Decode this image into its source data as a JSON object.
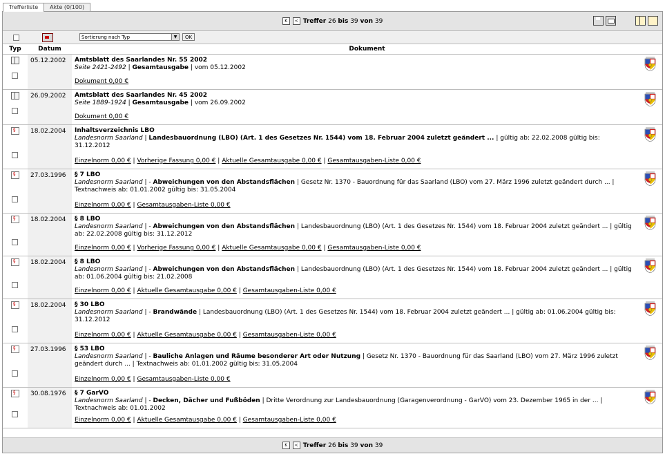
{
  "tabs": [
    {
      "label": "Trefferliste"
    },
    {
      "label": "Akte (0/100)"
    }
  ],
  "pager": {
    "prefix": "Treffer",
    "from": "26",
    "bis": "bis",
    "to": "39",
    "von": "von",
    "total": "39"
  },
  "sort": {
    "selected": "Sortierung nach Typ",
    "ok_label": "OK"
  },
  "columns": {
    "typ": "Typ",
    "datum": "Datum",
    "dokument": "Dokument"
  },
  "rows": [
    {
      "icon": "book-icon",
      "date": "05.12.2002",
      "title": "Amtsblatt des Saarlandes Nr. 55 2002",
      "line2_italic": "Seite 2421-2492",
      "line2_sep": "|",
      "line2_bold": "Gesamtausgabe",
      "line2_rest": "| vom 05.12.2002",
      "links": [
        "Dokument 0,00 €"
      ]
    },
    {
      "icon": "book-icon",
      "date": "26.09.2002",
      "title": "Amtsblatt des Saarlandes Nr. 45 2002",
      "line2_italic": "Seite 1889-1924",
      "line2_sep": "|",
      "line2_bold": "Gesamtausgabe",
      "line2_rest": "| vom 26.09.2002",
      "links": [
        "Dokument 0,00 €"
      ]
    },
    {
      "icon": "norm-icon",
      "date": "18.02.2004",
      "title": "Inhaltsverzeichnis LBO",
      "line2_italic": "Landesnorm Saarland",
      "line2_sep": "|",
      "line2_bold": "Landesbauordnung (LBO) (Art. 1 des Gesetzes Nr. 1544) vom 18. Februar 2004 zuletzt geändert ...",
      "line2_rest": "| gültig ab: 22.02.2008 gültig bis: 31.12.2012",
      "links": [
        "Einzelnorm 0,00 €",
        "Vorherige Fassung 0,00 €",
        "Aktuelle Gesamtausgabe 0,00 €",
        "Gesamtausgaben-Liste 0,00 €"
      ]
    },
    {
      "icon": "norm-icon",
      "date": "27.03.1996",
      "title": "§ 7 LBO",
      "line2_italic": "Landesnorm Saarland",
      "line2_sep": "| -",
      "line2_bold": "Abweichungen von den Abstandsflächen",
      "line2_rest": "| Gesetz Nr. 1370 - Bauordnung für das Saarland (LBO) vom 27. März 1996 zuletzt geändert durch ... | Textnachweis ab: 01.01.2002 gültig bis: 31.05.2004",
      "links": [
        "Einzelnorm 0,00 €",
        "Gesamtausgaben-Liste 0,00 €"
      ]
    },
    {
      "icon": "norm-icon",
      "date": "18.02.2004",
      "title": "§ 8 LBO",
      "line2_italic": "Landesnorm Saarland",
      "line2_sep": "| -",
      "line2_bold": "Abweichungen von den Abstandsflächen",
      "line2_rest": "| Landesbauordnung (LBO) (Art. 1 des Gesetzes Nr. 1544) vom 18. Februar 2004 zuletzt geändert ... | gültig ab: 22.02.2008 gültig bis: 31.12.2012",
      "links": [
        "Einzelnorm 0,00 €",
        "Vorherige Fassung 0,00 €",
        "Aktuelle Gesamtausgabe 0,00 €",
        "Gesamtausgaben-Liste 0,00 €"
      ]
    },
    {
      "icon": "norm-icon",
      "date": "18.02.2004",
      "title": "§ 8 LBO",
      "line2_italic": "Landesnorm Saarland",
      "line2_sep": "| -",
      "line2_bold": "Abweichungen von den Abstandsflächen",
      "line2_rest": "| Landesbauordnung (LBO) (Art. 1 des Gesetzes Nr. 1544) vom 18. Februar 2004 zuletzt geändert ... | gültig ab: 01.06.2004 gültig bis: 21.02.2008",
      "links": [
        "Einzelnorm 0,00 €",
        "Aktuelle Gesamtausgabe 0,00 €",
        "Gesamtausgaben-Liste 0,00 €"
      ]
    },
    {
      "icon": "norm-icon",
      "date": "18.02.2004",
      "title": "§ 30 LBO",
      "line2_italic": "Landesnorm Saarland",
      "line2_sep": "| -",
      "line2_bold": "Brandwände",
      "line2_rest": "| Landesbauordnung (LBO) (Art. 1 des Gesetzes Nr. 1544) vom 18. Februar 2004 zuletzt geändert ... | gültig ab: 01.06.2004 gültig bis: 31.12.2012",
      "links": [
        "Einzelnorm 0,00 €",
        "Aktuelle Gesamtausgabe 0,00 €",
        "Gesamtausgaben-Liste 0,00 €"
      ]
    },
    {
      "icon": "norm-icon",
      "date": "27.03.1996",
      "title": "§ 53 LBO",
      "line2_italic": "Landesnorm Saarland",
      "line2_sep": "| -",
      "line2_bold": "Bauliche Anlagen und Räume besonderer Art oder Nutzung",
      "line2_rest": "| Gesetz Nr. 1370 - Bauordnung für das Saarland (LBO) vom 27. März 1996 zuletzt geändert durch ... | Textnachweis ab: 01.01.2002 gültig bis: 31.05.2004",
      "links": [
        "Einzelnorm 0,00 €",
        "Gesamtausgaben-Liste 0,00 €"
      ]
    },
    {
      "icon": "norm-icon",
      "date": "30.08.1976",
      "title": "§ 7 GarVO",
      "line2_italic": "Landesnorm Saarland",
      "line2_sep": "| -",
      "line2_bold": "Decken, Dächer und Fußböden",
      "line2_rest": "| Dritte Verordnung zur Landesbauordnung (Garagenverordnung - GarVO) vom 23. Dezember 1965 in der ... | Textnachweis ab: 01.01.2002",
      "links": [
        "Einzelnorm 0,00 €",
        "Aktuelle Gesamtausgabe 0,00 €",
        "Gesamtausgaben-Liste 0,00 €"
      ]
    }
  ],
  "colors": {
    "bar_bg": "#e4e4e4",
    "date_col_bg": "#f0f0f0",
    "border": "#bcbcbc",
    "crest_blue": "#2a4fb5",
    "crest_red": "#d11f1f",
    "crest_gold": "#e8c000"
  }
}
